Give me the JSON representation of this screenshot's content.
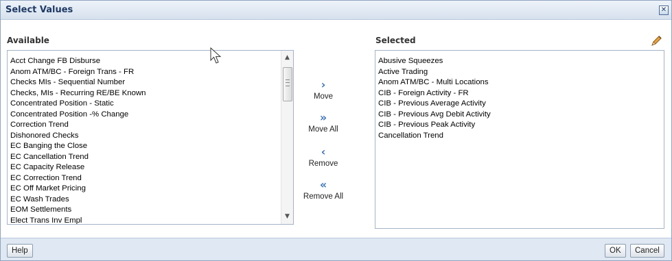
{
  "dialog": {
    "title": "Select Values",
    "close_symbol": "✕"
  },
  "available": {
    "label": "Available",
    "items": [
      "Acct Change FB Disburse",
      "Anom ATM/BC - Foreign Trans - FR",
      "Checks MIs - Sequential Number",
      "Checks, MIs - Recurring RE/BE Known",
      "Concentrated Position - Static",
      "Concentrated Position -% Change",
      "Correction Trend",
      "Dishonored Checks",
      "EC Banging the Close",
      "EC Cancellation Trend",
      "EC Capacity Release",
      "EC Correction Trend",
      "EC Off Market Pricing",
      "EC Wash Trades",
      "EOM Settlements",
      "Elect Trans Inv Empl"
    ]
  },
  "shuttle": {
    "move": {
      "label": "Move",
      "icon": "›"
    },
    "move_all": {
      "label": "Move All",
      "icon": "»"
    },
    "remove": {
      "label": "Remove",
      "icon": "‹"
    },
    "remove_all": {
      "label": "Remove All",
      "icon": "«"
    }
  },
  "selected": {
    "label": "Selected",
    "items": [
      "Abusive Squeezes",
      "Active Trading",
      "Anom ATM/BC - Multi Locations",
      "CIB - Foreign Activity - FR",
      "CIB - Previous Average Activity",
      "CIB - Previous Avg Debit Activity",
      "CIB - Previous Peak Activity",
      "Cancellation Trend"
    ]
  },
  "footer": {
    "help": "Help",
    "ok": "OK",
    "cancel": "Cancel"
  },
  "icons": {
    "scroll_up": "▲",
    "scroll_down": "▼",
    "pencil": "pencil-icon",
    "cursor": "mouse-pointer-icon"
  },
  "colors": {
    "title_text": "#1f3a64",
    "shuttle_icon": "#3b73b9",
    "footer_bg": "#dfe8f3",
    "pencil_body": "#e8a33c"
  }
}
